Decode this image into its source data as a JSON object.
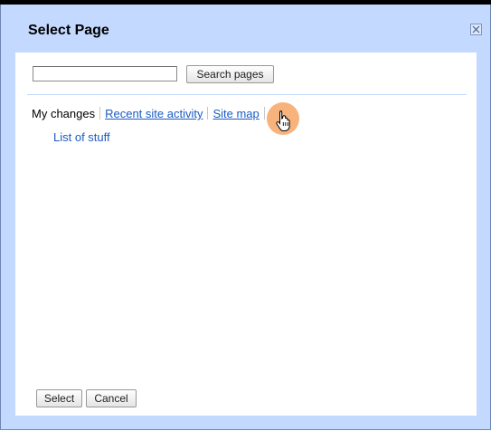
{
  "dialog": {
    "title": "Select Page",
    "close_icon": "close-icon"
  },
  "search": {
    "value": "",
    "placeholder": "",
    "button_label": "Search pages"
  },
  "tabs": [
    {
      "label": "My changes",
      "selected": true
    },
    {
      "label": "Recent site activity",
      "selected": false
    },
    {
      "label": "Site map",
      "selected": false
    }
  ],
  "tree": {
    "items": [
      {
        "label": "List of stuff"
      }
    ]
  },
  "footer": {
    "select_label": "Select",
    "cancel_label": "Cancel"
  },
  "cursor": {
    "icon": "hand-pointer-icon",
    "highlight_color": "#f48a38"
  },
  "colors": {
    "dialog_background": "#c3d9ff",
    "link": "#1a5bc4"
  }
}
